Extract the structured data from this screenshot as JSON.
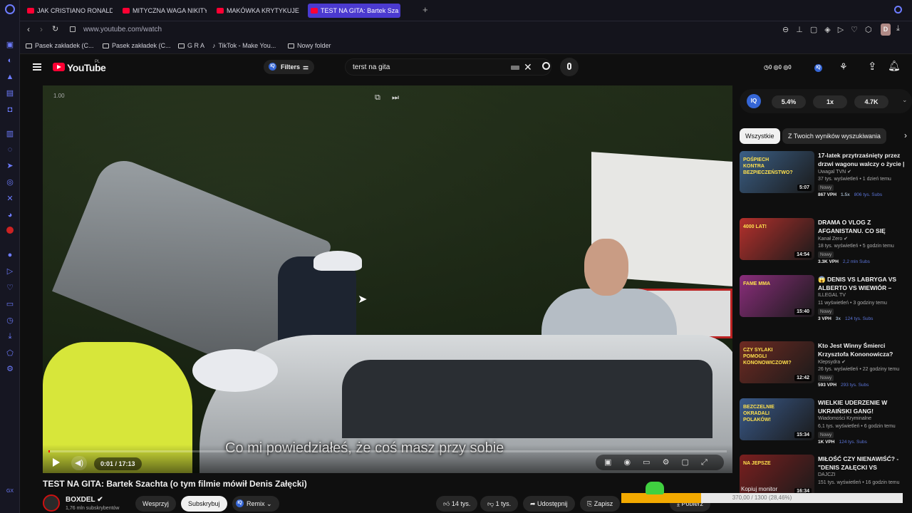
{
  "tabs": [
    {
      "label": "JAK CRISTIANO RONALDO"
    },
    {
      "label": "MITYCZNA WAGA NIKITY"
    },
    {
      "label": "MAKÓWKA KRYTYKUJE"
    },
    {
      "label": "TEST NA GITA: Bartek Sza"
    }
  ],
  "address": {
    "url": "www.youtube.com/watch"
  },
  "bookmarks": [
    "Pasek zakładek (C...",
    "Pasek zakładek (C...",
    "G R A",
    "TikTok - Make You...",
    "Nowy folder"
  ],
  "header": {
    "logo": "YouTube",
    "country": "PL",
    "filters": "Filters",
    "search_query": "terst na gita",
    "counts": [
      "0",
      "0",
      "0"
    ]
  },
  "video": {
    "speed": "1.00",
    "subtitle": "Co mi powiedziałeś, że coś masz przy sobie",
    "time": "0:01 / 17:13",
    "progress": 0.001
  },
  "iq_bar": {
    "pct": "5.4%",
    "mult": "1x",
    "views": "4.7K"
  },
  "chips": [
    "Wszystkie",
    "Z Twoich wyników wyszukiwania"
  ],
  "recs": [
    {
      "title": "17-latek przytrzaśnięty przez drzwi wagonu walczy o życie | ...",
      "channel": "Uwagal TVN ✔",
      "meta": "37 tys. wyświetleń • 1 dzień temu",
      "badge": "Nowy",
      "vph": "867 VPH",
      "x": "1.5x",
      "subs": "806 tys. Subs",
      "duration": "5:07",
      "thumb_text": "POŚPIECH KONTRA BEZPIECZEŃSTWO?",
      "color": "#3b5f86"
    },
    {
      "title": "DRAMA O VLOG Z AFGANISTANU. CO SIĘ DZIEJ...",
      "channel": "Kanał Zero ✔",
      "meta": "18 tys. wyświetleń • 5 godzin temu",
      "badge": "Nowy",
      "vph": "3.3K VPH",
      "x": "",
      "subs": "2,2 mln Subs",
      "duration": "14:54",
      "thumb_text": "4000 LAT!",
      "color": "#b4302c"
    },
    {
      "title": "😱 DENIS VS LABRYGA VS ALBERTO VS WIEWIÓR – W***...",
      "channel": "ILLEGAL TV",
      "meta": "11 wyświetleń • 3 godziny temu",
      "badge": "Nowy",
      "vph": "3 VPH",
      "x": "3x",
      "subs": "124 tys. Subs",
      "duration": "15:40",
      "thumb_text": "FAME MMA",
      "color": "#8a2d7b"
    },
    {
      "title": "Kto Jest Winny Śmierci Krzysztofa Kononowicza?",
      "channel": "Klepsydra ✔",
      "meta": "26 tys. wyświetleń • 22 godziny temu",
      "badge": "Nowy",
      "vph": "593 VPH",
      "x": "",
      "subs": "293 tys. Subs",
      "duration": "12:42",
      "thumb_text": "CZY SYLAKI POMOGLI KONONOWICZOWI?",
      "color": "#6e2a22"
    },
    {
      "title": "WIELKIE UDERZENIE W UKRAIŃSKI GANG!",
      "channel": "Wiadomości Kryminalne",
      "meta": "6,1 tys. wyświetleń • 6 godzin temu",
      "badge": "Nowy",
      "vph": "1K VPH",
      "x": "",
      "subs": "124 tys. Subs",
      "duration": "15:34",
      "thumb_text": "BEZCZELNIE OKRADALI POLAKÓW!",
      "color": "#3a5a8a"
    },
    {
      "title": "MIŁOŚĆ CZY NIENAWIŚĆ? - \"DENIS ZAŁĘCKI VS SZACHTA...",
      "channel": "DAJCZI",
      "meta": "151 tys. wyświetleń • 16 godzin temu",
      "badge": "",
      "vph": "",
      "x": "",
      "subs": "",
      "duration": "16:34",
      "thumb_text": "NA JEPSZE",
      "color": "#7a1f1f"
    }
  ],
  "main": {
    "title": "TEST NA GITA: Bartek Szachta (o tym filmie mówił Denis Załęcki)",
    "channel": "BOXDEL ✔",
    "subs": "1,76 mln subskrybentów",
    "support": "Wesprzyj",
    "subscribe": "Subskrybuj",
    "remix": "Remix",
    "likes": "14 tys.",
    "dislikes": "1 tys.",
    "share": "Udostępnij",
    "save": "Zapisz",
    "download": "Pobierz",
    "overlay_stats": "370,00 / 1300 (28,46%)",
    "overlay_label": "Kopiuj monitor"
  },
  "colors": {
    "accent": "#4b3ad0",
    "yt_red": "#ff0033",
    "iq_blue": "#3566d6"
  }
}
